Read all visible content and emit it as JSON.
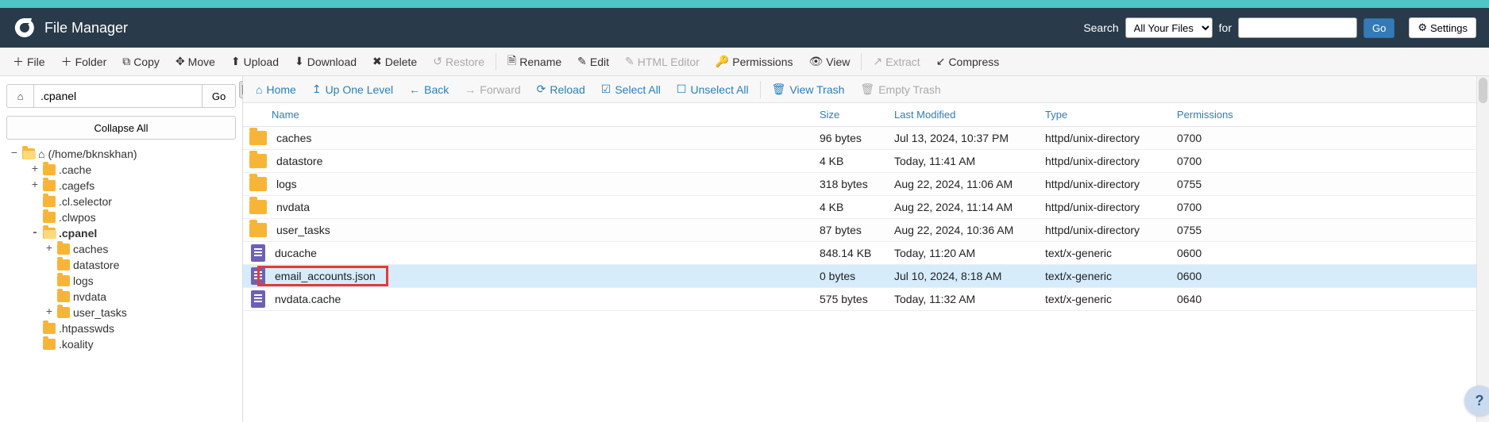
{
  "header": {
    "title": "File Manager",
    "search_label": "Search",
    "dropdown_selected": "All Your Files",
    "dropdown_options": [
      "All Your Files"
    ],
    "for_label": "for",
    "search_value": "",
    "go_label": "Go",
    "settings_label": "Settings"
  },
  "toolbar": {
    "file": "File",
    "folder": "Folder",
    "copy": "Copy",
    "move": "Move",
    "upload": "Upload",
    "download": "Download",
    "delete": "Delete",
    "restore": "Restore",
    "rename": "Rename",
    "edit": "Edit",
    "html_editor": "HTML Editor",
    "permissions": "Permissions",
    "view": "View",
    "extract": "Extract",
    "compress": "Compress"
  },
  "sidebar": {
    "path_value": ".cpanel",
    "go_label": "Go",
    "collapse_label": "Collapse All",
    "tree": {
      "root": "(/home/bknskhan)",
      "items": [
        {
          "sign": "+",
          "label": ".cache",
          "indent": 1,
          "open": false
        },
        {
          "sign": "+",
          "label": ".cagefs",
          "indent": 1,
          "open": false
        },
        {
          "sign": "",
          "label": ".cl.selector",
          "indent": 1,
          "open": false,
          "nosign": true
        },
        {
          "sign": "",
          "label": ".clwpos",
          "indent": 1,
          "open": false,
          "nosign": true
        },
        {
          "sign": "-",
          "label": ".cpanel",
          "indent": 1,
          "open": true,
          "bold": true
        },
        {
          "sign": "+",
          "label": "caches",
          "indent": 2,
          "open": false
        },
        {
          "sign": "",
          "label": "datastore",
          "indent": 2,
          "open": false,
          "nosign": true
        },
        {
          "sign": "",
          "label": "logs",
          "indent": 2,
          "open": false,
          "nosign": true
        },
        {
          "sign": "",
          "label": "nvdata",
          "indent": 2,
          "open": false,
          "nosign": true
        },
        {
          "sign": "+",
          "label": "user_tasks",
          "indent": 2,
          "open": false
        },
        {
          "sign": "",
          "label": ".htpasswds",
          "indent": 1,
          "open": false,
          "nosign": true
        },
        {
          "sign": "",
          "label": ".koality",
          "indent": 1,
          "open": false,
          "nosign": true
        }
      ]
    }
  },
  "content_toolbar": {
    "home": "Home",
    "up_one": "Up One Level",
    "back": "Back",
    "forward": "Forward",
    "reload": "Reload",
    "select_all": "Select All",
    "unselect_all": "Unselect All",
    "view_trash": "View Trash",
    "empty_trash": "Empty Trash"
  },
  "grid_headers": {
    "name": "Name",
    "size": "Size",
    "last_modified": "Last Modified",
    "type": "Type",
    "permissions": "Permissions"
  },
  "files": [
    {
      "icon": "folder",
      "name": "caches",
      "size": "96 bytes",
      "modified": "Jul 13, 2024, 10:37 PM",
      "type": "httpd/unix-directory",
      "perm": "0700"
    },
    {
      "icon": "folder",
      "name": "datastore",
      "size": "4 KB",
      "modified": "Today, 11:41 AM",
      "type": "httpd/unix-directory",
      "perm": "0700"
    },
    {
      "icon": "folder",
      "name": "logs",
      "size": "318 bytes",
      "modified": "Aug 22, 2024, 11:06 AM",
      "type": "httpd/unix-directory",
      "perm": "0755"
    },
    {
      "icon": "folder",
      "name": "nvdata",
      "size": "4 KB",
      "modified": "Aug 22, 2024, 11:14 AM",
      "type": "httpd/unix-directory",
      "perm": "0700"
    },
    {
      "icon": "folder",
      "name": "user_tasks",
      "size": "87 bytes",
      "modified": "Aug 22, 2024, 10:36 AM",
      "type": "httpd/unix-directory",
      "perm": "0755"
    },
    {
      "icon": "file",
      "name": "ducache",
      "size": "848.14 KB",
      "modified": "Today, 11:20 AM",
      "type": "text/x-generic",
      "perm": "0600"
    },
    {
      "icon": "file",
      "name": "email_accounts.json",
      "size": "0 bytes",
      "modified": "Jul 10, 2024, 8:18 AM",
      "type": "text/x-generic",
      "perm": "0600",
      "selected": true,
      "highlight": true
    },
    {
      "icon": "file",
      "name": "nvdata.cache",
      "size": "575 bytes",
      "modified": "Today, 11:32 AM",
      "type": "text/x-generic",
      "perm": "0640"
    }
  ],
  "help_label": "?",
  "colors": {
    "accent": "#2a7fba",
    "header_bg": "#293a4a",
    "teal": "#4fc5c5",
    "highlight": "#e53935"
  }
}
